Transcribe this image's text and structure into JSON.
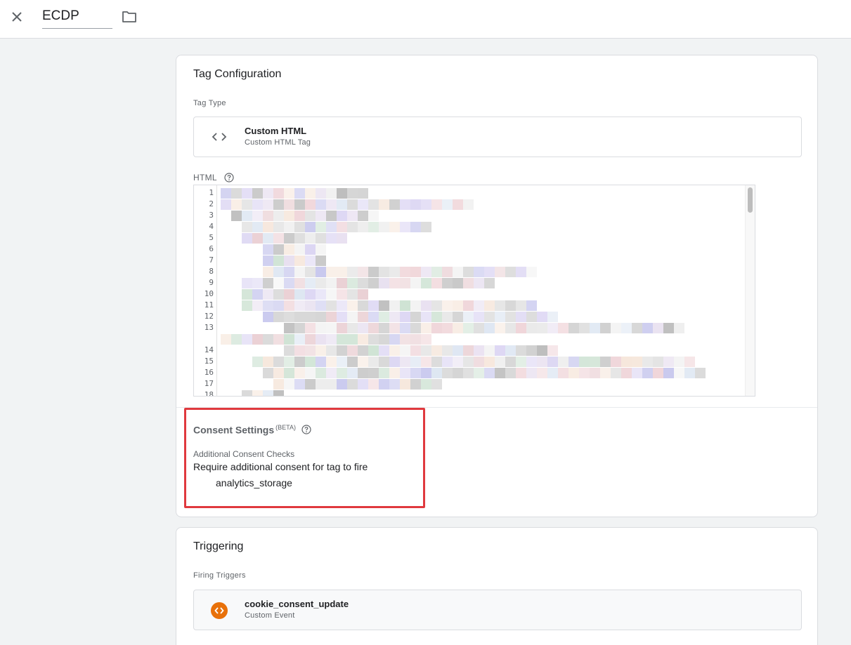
{
  "header": {
    "tag_name": "ECDP",
    "close_icon": "close-icon",
    "folder_icon": "folder-icon"
  },
  "tag_config": {
    "title": "Tag Configuration",
    "tag_type_label": "Tag Type",
    "tag_type": {
      "name": "Custom HTML",
      "description": "Custom HTML Tag",
      "icon": "code-brackets-icon"
    },
    "html_label": "HTML",
    "editor": {
      "line_numbers": [
        "1",
        "2",
        "3",
        "4",
        "5",
        "6",
        "7",
        "8",
        "9",
        "10",
        "11",
        "12",
        "13",
        "14",
        "15",
        "16",
        "17",
        "18"
      ]
    },
    "consent": {
      "title": "Consent Settings",
      "beta": "(BETA)",
      "subtitle": "Additional Consent Checks",
      "requirement": "Require additional consent for tag to fire",
      "consent_type": "analytics_storage"
    }
  },
  "triggering": {
    "title": "Triggering",
    "firing_label": "Firing Triggers",
    "trigger": {
      "name": "cookie_consent_update",
      "type": "Custom Event",
      "icon": "custom-event-icon"
    }
  },
  "colors": {
    "highlight_border": "#e0393e",
    "trigger_icon": "#e8710a"
  }
}
